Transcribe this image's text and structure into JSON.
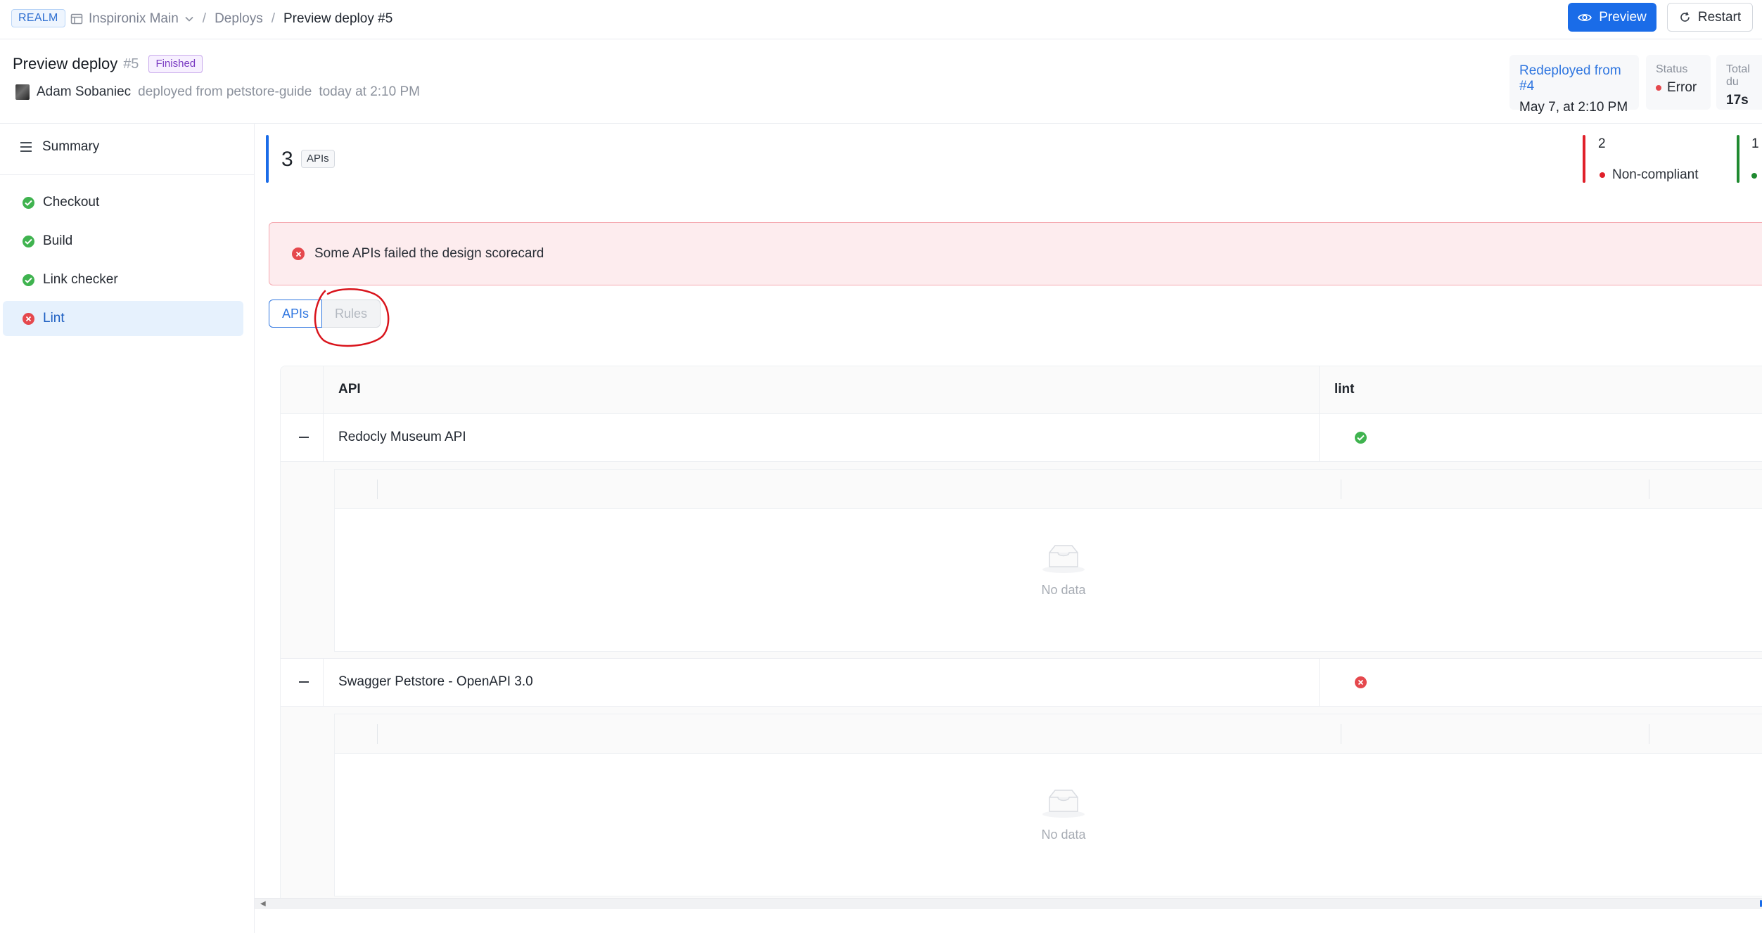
{
  "topbar": {
    "realm": "REALM",
    "workspace": "Inspironix Main",
    "breadcrumbs": [
      "Deploys",
      "Preview deploy #5"
    ],
    "preview_label": "Preview",
    "restart_label": "Restart"
  },
  "header": {
    "title": "Preview deploy",
    "number": "#5",
    "status_badge": "Finished",
    "author": "Adam Sobaniec",
    "deployed_from": "deployed from petstore-guide",
    "time": "today at 2:10 PM",
    "redeploy": {
      "link": "Redeployed from #4",
      "date": "May 7, at 2:10 PM"
    },
    "status": {
      "label": "Status",
      "value": "Error"
    },
    "total_duration": {
      "label": "Total du",
      "value": "17s"
    }
  },
  "sidebar": {
    "summary_label": "Summary",
    "items": [
      {
        "label": "Checkout",
        "state": "success"
      },
      {
        "label": "Build",
        "state": "success"
      },
      {
        "label": "Link checker",
        "state": "success"
      },
      {
        "label": "Lint",
        "state": "error",
        "active": true
      }
    ]
  },
  "stats": {
    "apis_count": "3",
    "apis_label": "APIs",
    "noncompliant_count": "2",
    "noncompliant_label": "Non-compliant",
    "compliant_count": "1"
  },
  "alert": {
    "text": "Some APIs failed the design scorecard"
  },
  "tabs": [
    "APIs",
    "Rules"
  ],
  "table": {
    "columns": [
      "API",
      "lint"
    ],
    "rows": [
      {
        "name": "Redocly Museum API",
        "lint": "success",
        "empty_text": "No data"
      },
      {
        "name": "Swagger Petstore - OpenAPI 3.0",
        "lint": "error",
        "empty_text": "No data"
      }
    ]
  },
  "colors": {
    "primary": "#1a6ce8",
    "error": "#e5484d",
    "success": "#3fb34f",
    "annotation": "#d9141c"
  }
}
